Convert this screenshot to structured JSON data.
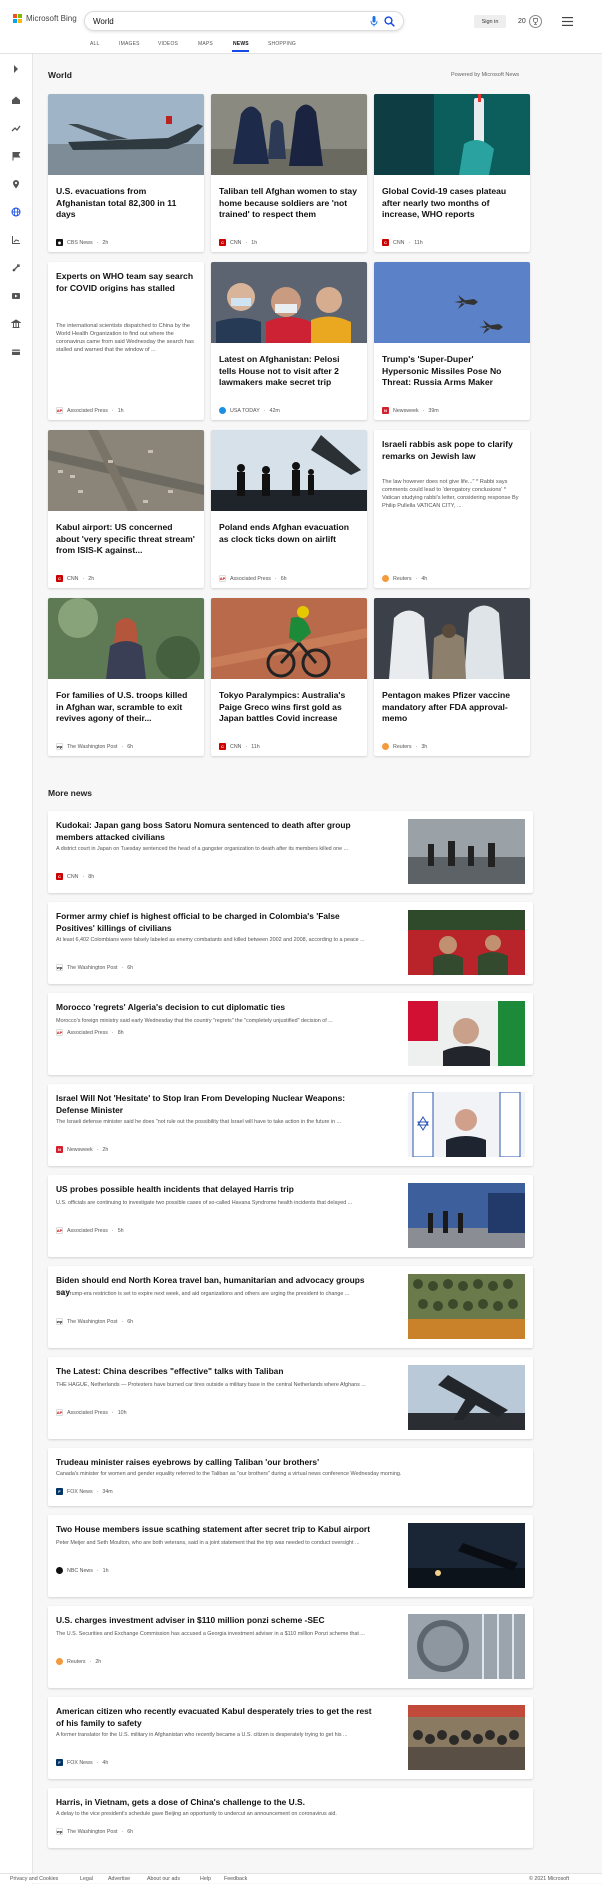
{
  "header": {
    "brand": "Microsoft Bing",
    "search_value": "World",
    "signin_label": "Sign in",
    "rewards_count": "20",
    "tabs": [
      "ALL",
      "IMAGES",
      "VIDEOS",
      "MAPS",
      "NEWS",
      "SHOPPING"
    ],
    "active_tab": "NEWS",
    "colors": {
      "accent": "#174ae4",
      "logo": [
        "#f25022",
        "#7fba00",
        "#00a4ef",
        "#ffb900"
      ]
    }
  },
  "left_nav": {
    "icons": [
      "expand-icon",
      "home-icon",
      "trending-icon",
      "flag-icon",
      "location-icon",
      "globe-icon",
      "chart-icon",
      "science-icon",
      "entertainment-icon",
      "business-icon",
      "money-icon"
    ]
  },
  "world": {
    "title": "World",
    "powered_by": "Powered by Microsoft News",
    "cards": [
      {
        "title": "U.S. evacuations from Afghanistan total 82,300 in 11 days",
        "source": "CBS News",
        "age": "2h",
        "desc": ""
      },
      {
        "title": "Taliban tell Afghan women to stay home because soldiers are 'not trained' to respect them",
        "source": "CNN",
        "age": "1h",
        "desc": ""
      },
      {
        "title": "Global Covid-19 cases plateau after nearly two months of increase, WHO reports",
        "source": "CNN",
        "age": "11h",
        "desc": ""
      },
      {
        "title": "Experts on WHO team say search for COVID origins has stalled",
        "source": "Associated Press",
        "age": "1h",
        "desc": "The international scientists dispatched to China by the World Health Organization to find out where the coronavirus came from said Wednesday the search has stalled and warned that the window of ..."
      },
      {
        "title": "Latest on Afghanistan: Pelosi tells House not to visit after 2 lawmakers make secret trip",
        "source": "USA TODAY",
        "age": "42m",
        "desc": ""
      },
      {
        "title": "Trump's 'Super-Duper' Hypersonic Missiles Pose No Threat: Russia Arms Maker",
        "source": "Newsweek",
        "age": "39m",
        "desc": ""
      },
      {
        "title": "Kabul airport: US concerned about 'very specific threat stream' from ISIS-K against...",
        "source": "CNN",
        "age": "2h",
        "desc": ""
      },
      {
        "title": "Poland ends Afghan evacuation as clock ticks down on airlift",
        "source": "Associated Press",
        "age": "6h",
        "desc": ""
      },
      {
        "title": "Israeli rabbis ask pope to clarify remarks on Jewish law",
        "source": "Reuters",
        "age": "4h",
        "desc": "The law however does not give life...\" * Rabbi says comments could lead to 'derogatory conclusions' * Vatican studying rabbi's letter, considering response By Philip Pullella VATICAN CITY, ..."
      },
      {
        "title": "For families of U.S. troops killed in Afghan war, scramble to exit revives agony of their...",
        "source": "The Washington Post",
        "age": "6h",
        "desc": ""
      },
      {
        "title": "Tokyo Paralympics: Australia's Paige Greco wins first gold as Japan battles Covid increase",
        "source": "CNN",
        "age": "11h",
        "desc": ""
      },
      {
        "title": "Pentagon makes Pfizer vaccine mandatory after FDA approval-memo",
        "source": "Reuters",
        "age": "3h",
        "desc": ""
      }
    ]
  },
  "more_news": {
    "title": "More news",
    "items": [
      {
        "title": "Kudokai: Japan gang boss Satoru Nomura sentenced to death after group members attacked civilians",
        "desc": "A district court in Japan on Tuesday sentenced the head of a gangster organization to death after its members killed one ...",
        "source": "CNN",
        "age": "8h"
      },
      {
        "title": "Former army chief is highest official to be charged in Colombia's 'False Positives' killings of civilians",
        "desc": "At least 6,402 Colombians were falsely labeled as enemy combatants and killed between 2002 and 2008, according to a peace ...",
        "source": "The Washington Post",
        "age": "6h"
      },
      {
        "title": "Morocco 'regrets' Algeria's decision to cut diplomatic ties",
        "desc": "Morocco's foreign ministry said early Wednesday that the country \"regrets\" the \"completely unjustified\" decision of ...",
        "source": "Associated Press",
        "age": "8h"
      },
      {
        "title": "Israel Will Not 'Hesitate' to Stop Iran From Developing Nuclear Weapons: Defense Minister",
        "desc": "The Israeli defense minister said he does \"not rule out the possibility that Israel will have to take action in the future in ...",
        "source": "Newsweek",
        "age": "2h"
      },
      {
        "title": "US probes possible health incidents that delayed Harris trip",
        "desc": "U.S. officials are continuing to investigate two possible cases of so-called Havana Syndrome health incidents that delayed ...",
        "source": "Associated Press",
        "age": "5h"
      },
      {
        "title": "Biden should end North Korea travel ban, humanitarian and advocacy groups say",
        "desc": "The Trump-era restriction is set to expire next week, and aid organizations and others are urging the president to change ...",
        "source": "The Washington Post",
        "age": "6h"
      },
      {
        "title": "The Latest: China describes \"effective\" talks with Taliban",
        "desc": "THE HAGUE, Netherlands — Protesters have burned car tires outside a military base in the central Netherlands where Afghans ...",
        "source": "Associated Press",
        "age": "10h"
      },
      {
        "title": "Trudeau minister raises eyebrows by calling Taliban 'our brothers'",
        "desc": "Canada's minister for women and gender equality referred to the Taliban as \"our brothers\" during a virtual news conference Wednesday morning.",
        "source": "FOX News",
        "age": "34m"
      },
      {
        "title": "Two House members issue scathing statement after secret trip to Kabul airport",
        "desc": "Peter Meijer and Seth Moulton, who are both veterans, said in a joint statement that the trip was needed to conduct oversight ...",
        "source": "NBC News",
        "age": "1h"
      },
      {
        "title": "U.S. charges investment adviser in $110 million ponzi scheme -SEC",
        "desc": "The U.S. Securities and Exchange Commission has accused a Georgia investment adviser in a $110 million Ponzi scheme that ...",
        "source": "Reuters",
        "age": "2h"
      },
      {
        "title": "American citizen who recently evacuated Kabul desperately tries to get the rest of his family to safety",
        "desc": "A former translator for the U.S. military in Afghanistan who recently became a U.S. citizen is desperately trying to get his ...",
        "source": "FOX News",
        "age": "4h"
      },
      {
        "title": "Harris, in Vietnam, gets a dose of China's challenge to the U.S.",
        "desc": "A delay to the vice president's schedule gave Beijing an opportunity to undercut an announcement on coronavirus aid.",
        "source": "The Washington Post",
        "age": "6h"
      }
    ]
  },
  "footer": {
    "links": [
      "Privacy and Cookies",
      "Legal",
      "Advertise",
      "About our ads",
      "Help",
      "Feedback"
    ],
    "copyright": "© 2021 Microsoft"
  }
}
